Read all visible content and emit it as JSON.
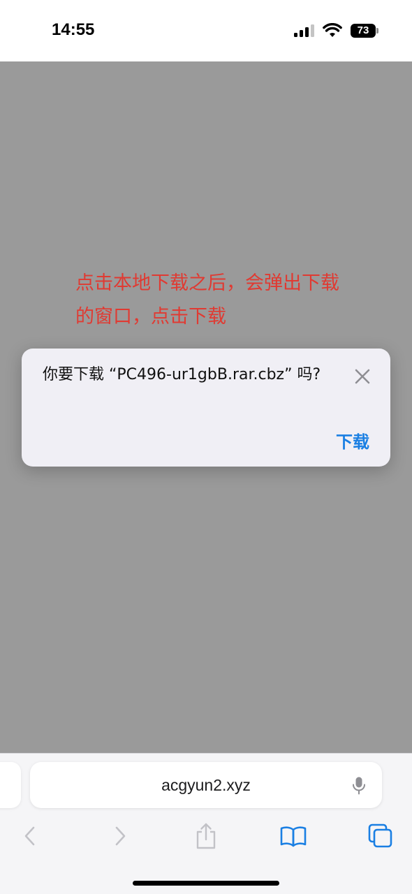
{
  "status_bar": {
    "time": "14:55",
    "battery_level": "73",
    "icons": [
      "cellular-signal-icon",
      "wifi-icon",
      "battery-icon"
    ]
  },
  "annotation": {
    "lines": [
      "点击本地下载之后，会弹出下载",
      "的窗口，点击下载"
    ],
    "color": "#e03a32"
  },
  "dialog": {
    "message": "你要下载 “PC496-ur1gbB.rar.cbz” 吗?",
    "download_label": "下载",
    "close_icon": "close-icon",
    "accent_color": "#1a7fe3"
  },
  "toolbar": {
    "address": "acgyun2.xyz",
    "icons": [
      "microphone-icon",
      "back-icon",
      "forward-icon",
      "share-icon",
      "bookmarks-icon",
      "tabs-icon"
    ]
  },
  "colors": {
    "page_overlay": "#9a9a9a",
    "toolbar_bg": "#f5f5f7",
    "dialog_bg": "#f0eff5"
  }
}
